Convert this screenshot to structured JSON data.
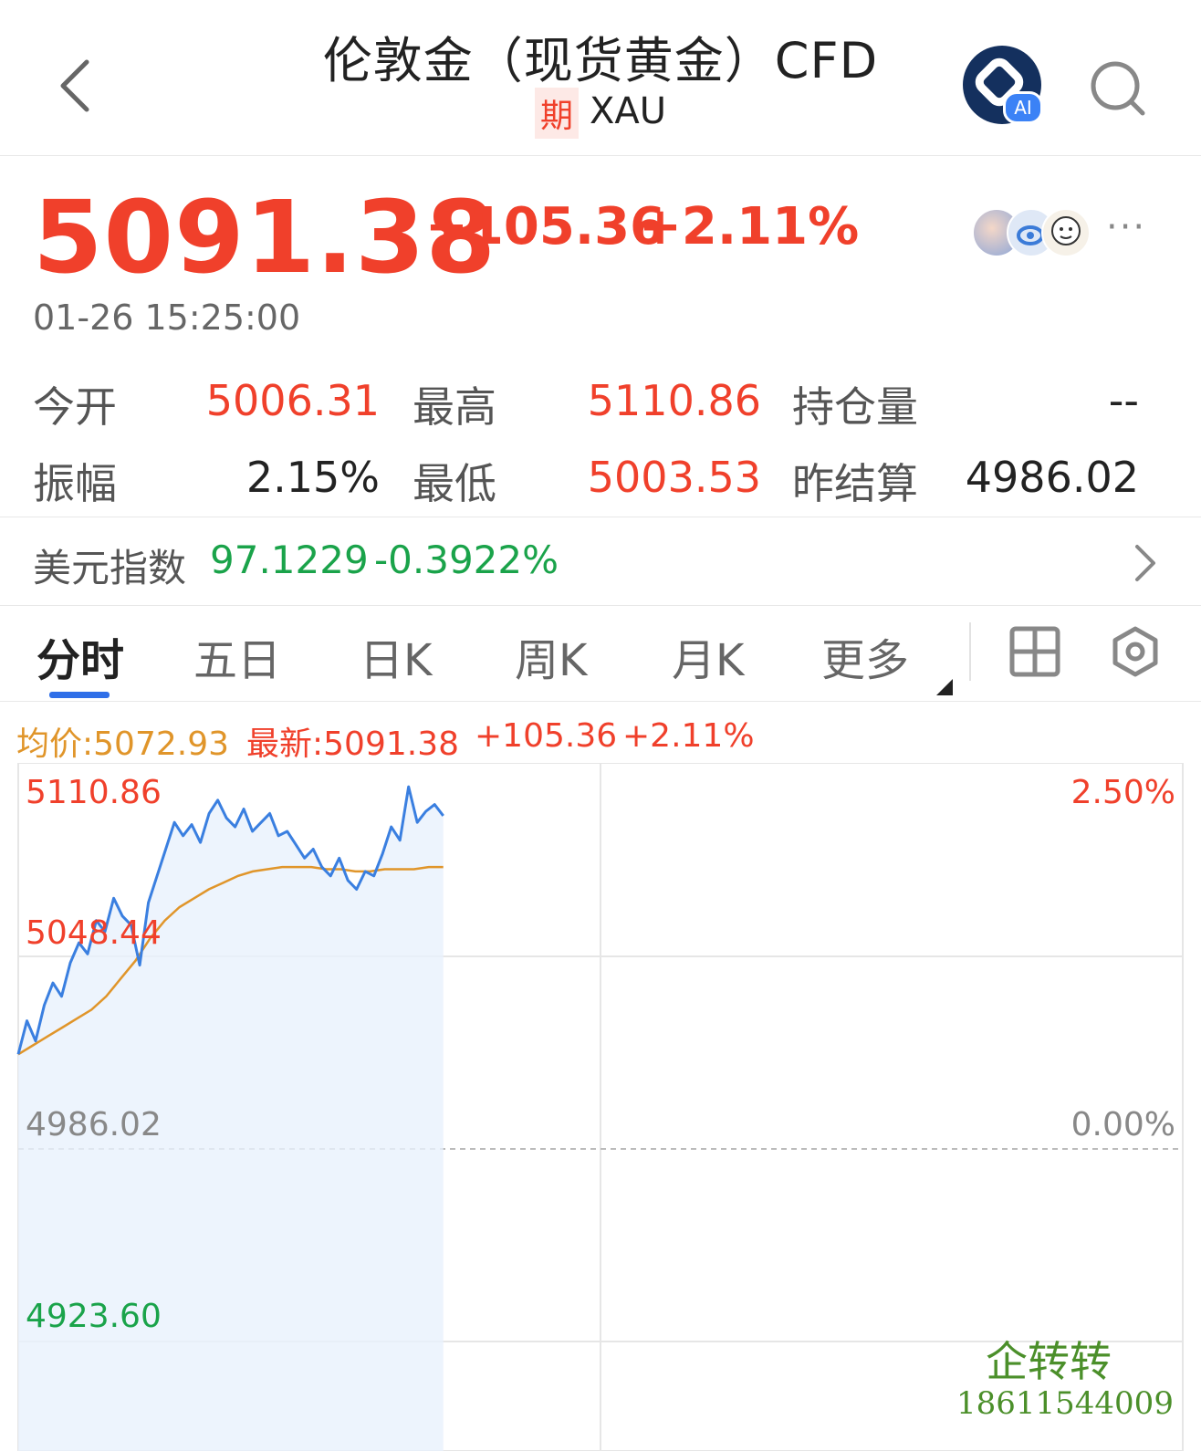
{
  "header": {
    "title": "伦敦金（现货黄金）CFD",
    "badge": "期",
    "symbol": "XAU",
    "ai_label": "AI"
  },
  "quote": {
    "price": "5091.38",
    "change": "+105.36",
    "change_pct": "+2.11%",
    "timestamp": "01-26 15:25:00",
    "more": "···"
  },
  "stats": {
    "open_label": "今开",
    "open": "5006.31",
    "high_label": "最高",
    "high": "5110.86",
    "oi_label": "持仓量",
    "oi": "--",
    "amp_label": "振幅",
    "amp": "2.15%",
    "low_label": "最低",
    "low": "5003.53",
    "prev_label": "昨结算",
    "prev": "4986.02"
  },
  "usd_index": {
    "label": "美元指数",
    "value": "97.1229",
    "change": "-0.3922%"
  },
  "tabs": [
    "分时",
    "五日",
    "日K",
    "周K",
    "月K",
    "更多"
  ],
  "chart_info": {
    "avg": "均价:5072.93",
    "latest": "最新:5091.38",
    "change": "+105.36",
    "change_pct": "+2.11%"
  },
  "chart_data": {
    "type": "line",
    "series": [
      {
        "values": [
          4990,
          5005,
          4996,
          5012,
          5022,
          5016,
          5031,
          5040,
          5035,
          5050,
          5045,
          5060,
          5052,
          5048,
          5030,
          5058,
          5070,
          5082,
          5094,
          5088,
          5093,
          5085,
          5098,
          5104,
          5096,
          5092,
          5100,
          5090,
          5094,
          5098,
          5088,
          5090,
          5084,
          5078,
          5082,
          5074,
          5070,
          5078,
          5068,
          5064,
          5072,
          5070,
          5080,
          5092,
          5086,
          5110,
          5094,
          5099,
          5102,
          5097
        ],
        "x_end_fraction": 0.365
      },
      {
        "values": [
          4990,
          4994,
          4998,
          5002,
          5006,
          5010,
          5016,
          5024,
          5032,
          5042,
          5050,
          5056,
          5060,
          5064,
          5067,
          5070,
          5072,
          5073,
          5074,
          5074,
          5074,
          5073,
          5073,
          5072,
          5072,
          5073,
          5073,
          5073,
          5074,
          5074
        ],
        "x_end_fraction": 0.365
      }
    ],
    "y_left_ticks": [
      "5110.86",
      "5048.44",
      "4986.02",
      "4923.60"
    ],
    "y_right_ticks": [
      "2.50%",
      "0.00%"
    ],
    "ylim": [
      4861.18,
      5110.86
    ],
    "baseline": 4986.02
  },
  "watermark": {
    "brand": "企转转",
    "phone": "18611544009"
  },
  "colors": {
    "up": "#f0402b",
    "down": "#1aa34a",
    "price_line": "#3a7fe0",
    "avg_line": "#e0952a",
    "accent": "#2f6fe8"
  }
}
